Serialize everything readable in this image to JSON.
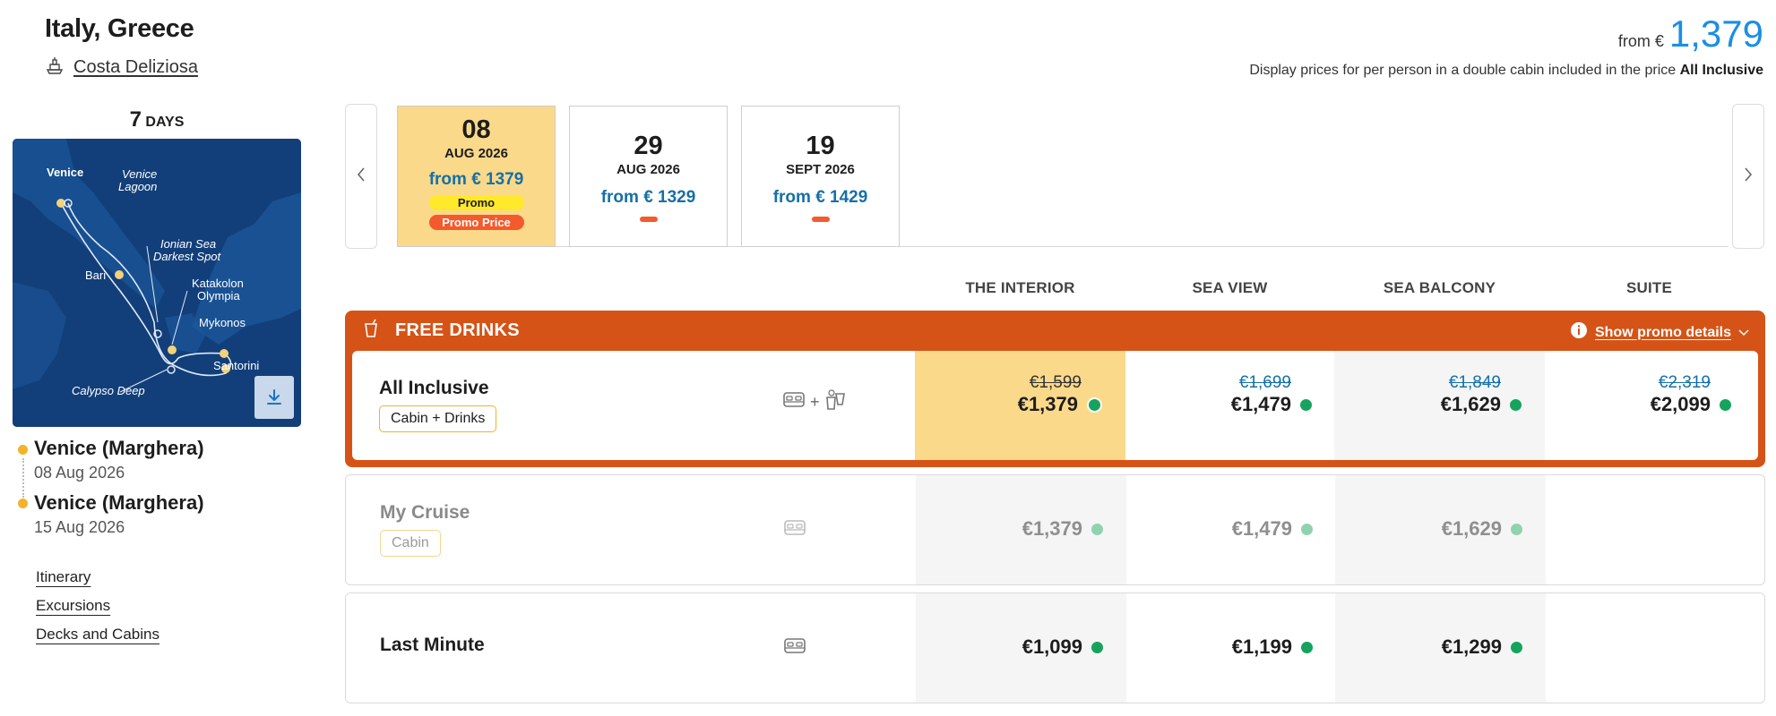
{
  "header": {
    "title": "Italy, Greece",
    "ship": "Costa Deliziosa",
    "price_prefix": "from €",
    "price": "1,379",
    "note_text": "Display prices for per person in a double cabin included in the price",
    "note_bold": "All Inclusive"
  },
  "trip": {
    "days_number": "7",
    "days_word": "DAYS",
    "map_labels": [
      "Venice",
      "Venice",
      "Lagoon",
      "Ionian Sea",
      "Darkest Spot",
      "Bari",
      "Katakolon",
      "Olympia",
      "Mykonos",
      "Santorini",
      "Calypso Deep"
    ]
  },
  "ports": [
    {
      "name": "Venice (Marghera)",
      "date": "08 Aug 2026"
    },
    {
      "name": "Venice (Marghera)",
      "date": "15 Aug 2026"
    }
  ],
  "links": [
    "Itinerary",
    "Excursions",
    "Decks and Cabins"
  ],
  "dates": [
    {
      "day": "08",
      "month": "AUG 2026",
      "price": "from € 1379",
      "badges": [
        "Promo",
        "Promo Price"
      ],
      "selected": true
    },
    {
      "day": "29",
      "month": "AUG 2026",
      "price": "from € 1329",
      "badges": [],
      "selected": false
    },
    {
      "day": "19",
      "month": "SEPT 2026",
      "price": "from € 1429",
      "badges": [],
      "selected": false
    }
  ],
  "cabin_types": [
    "THE INTERIOR",
    "SEA VIEW",
    "SEA BALCONY",
    "SUITE"
  ],
  "promo": {
    "title": "FREE DRINKS",
    "details_label": "Show promo details"
  },
  "fares": [
    {
      "name": "All Inclusive",
      "tag": "Cabin + Drinks",
      "prices": [
        {
          "old": "€1,599",
          "new": "€1,379"
        },
        {
          "old": "€1,699",
          "new": "€1,479"
        },
        {
          "old": "€1,849",
          "new": "€1,629"
        },
        {
          "old": "€2,319",
          "new": "€2,099"
        }
      ]
    },
    {
      "name": "My Cruise",
      "tag": "Cabin",
      "prices": [
        {
          "new": "€1,379"
        },
        {
          "new": "€1,479"
        },
        {
          "new": "€1,629"
        }
      ]
    },
    {
      "name": "Last Minute",
      "prices": [
        {
          "new": "€1,099"
        },
        {
          "new": "€1,199"
        },
        {
          "new": "€1,299"
        }
      ]
    }
  ],
  "colors": {
    "accent_blue": "#1a8fe3",
    "price_blue": "#1570a8",
    "promo_orange": "#d55317",
    "selected_yellow": "#fbd98a",
    "availability_green": "#15a35e"
  }
}
